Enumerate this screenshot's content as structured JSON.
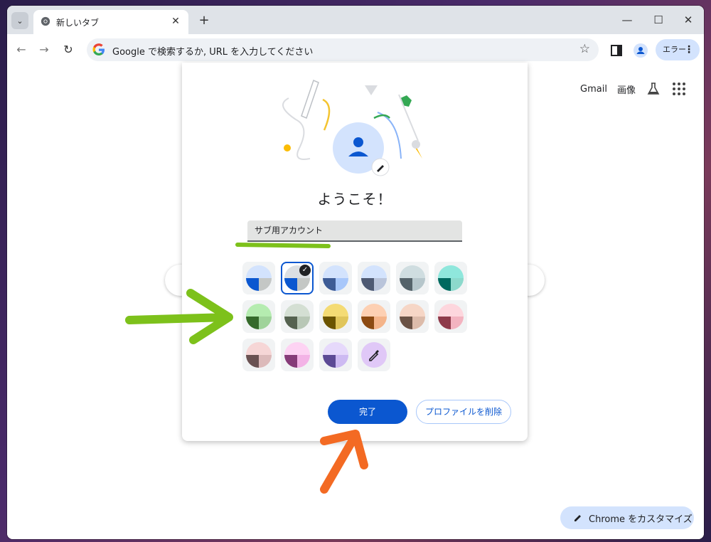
{
  "tab": {
    "title": "新しいタブ"
  },
  "omnibox": {
    "text": "Google で検索するか, URL を入力してください"
  },
  "profile_menu": {
    "label": "エラー"
  },
  "top_links": {
    "gmail": "Gmail",
    "images": "画像"
  },
  "dialog": {
    "welcome": "ようこそ！",
    "name_value": "サブ用アカウント",
    "done_label": "完了",
    "delete_label": "プロファイルを削除"
  },
  "colors": [
    {
      "top": "#d3e3fd",
      "bottom_left": "#0b57d0",
      "bottom_right": "#c4c7c5"
    },
    {
      "top": "#dcdfe3",
      "bottom_left": "#0b57d0",
      "bottom_right": "#c4c7c5",
      "selected": true
    },
    {
      "top": "#d3e3fd",
      "bottom_left": "#3e5c96",
      "bottom_right": "#a8c7fa"
    },
    {
      "top": "#d3e3fd",
      "bottom_left": "#4e5a73",
      "bottom_right": "#b9c4da"
    },
    {
      "top": "#cfdde0",
      "bottom_left": "#55636a",
      "bottom_right": "#b6c6cb"
    },
    {
      "top": "#8fe7dc",
      "bottom_left": "#00695f",
      "bottom_right": "#8cd9cc"
    },
    {
      "top": "#b5ecb0",
      "bottom_left": "#356a2b",
      "bottom_right": "#9fd39a"
    },
    {
      "top": "#d4dfd3",
      "bottom_left": "#55624f",
      "bottom_right": "#b8c7b6"
    },
    {
      "top": "#f4db74",
      "bottom_left": "#6b5400",
      "bottom_right": "#e0c55a"
    },
    {
      "top": "#fdd0b3",
      "bottom_left": "#8c4a12",
      "bottom_right": "#f4b48a"
    },
    {
      "top": "#f6d6c6",
      "bottom_left": "#6a5245",
      "bottom_right": "#dcbbaa"
    },
    {
      "top": "#fdd6dd",
      "bottom_left": "#8e3a4a",
      "bottom_right": "#f3b3c0"
    },
    {
      "top": "#f6d6d6",
      "bottom_left": "#6a5252",
      "bottom_right": "#dcbaba"
    },
    {
      "top": "#fdd3f3",
      "bottom_left": "#863b78",
      "bottom_right": "#f3b3e6"
    },
    {
      "top": "#e6d9fb",
      "bottom_left": "#5c4a95",
      "bottom_right": "#cdbaf2"
    }
  ],
  "custom_color": {
    "icon": "eyedropper-icon",
    "color": "#e0c8f7"
  },
  "customize": {
    "label": "Chrome をカスタマイズ"
  },
  "annotation_colors": {
    "green": "#7dc11b",
    "orange": "#f36a23"
  }
}
